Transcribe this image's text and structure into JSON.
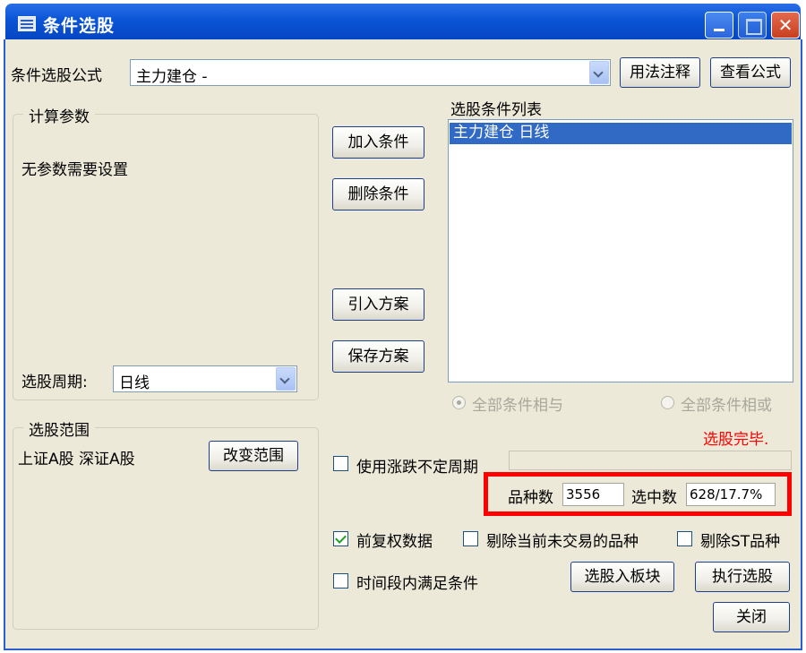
{
  "window": {
    "title": "条件选股"
  },
  "formula": {
    "label": "条件选股公式",
    "value": "主力建仓        -",
    "usage_button": "用法注释",
    "view_button": "查看公式"
  },
  "params": {
    "group_title": "计算参数",
    "message": "无参数需要设置",
    "period_label": "选股周期:",
    "period_value": "日线"
  },
  "scope": {
    "group_title": "选股范围",
    "text": "上证A股 深证A股",
    "change_button": "改变范围"
  },
  "actions": {
    "add": "加入条件",
    "delete": "删除条件",
    "import": "引入方案",
    "save": "保存方案"
  },
  "conditions": {
    "title": "选股条件列表",
    "items": [
      "主力建仓   日线"
    ],
    "and_label": "全部条件相与",
    "or_label": "全部条件相或"
  },
  "status": {
    "text": "选股完毕.",
    "color": "#ff0000"
  },
  "unfixed_period": {
    "label": "使用涨跌不定周期",
    "checked": false
  },
  "stats": {
    "count_label": "品种数",
    "count_value": "3556",
    "selected_label": "选中数",
    "selected_value": "628/17.7%",
    "highlight_color": "#ff0000"
  },
  "options": {
    "pre_adjusted": {
      "label": "前复权数据",
      "checked": true
    },
    "exclude_untraded": {
      "label": "剔除当前未交易的品种",
      "checked": false
    },
    "exclude_st": {
      "label": "剔除ST品种",
      "checked": false
    },
    "time_range": {
      "label": "时间段内满足条件",
      "checked": false
    }
  },
  "bottom_buttons": {
    "to_block": "选股入板块",
    "execute": "执行选股",
    "close": "关闭"
  }
}
